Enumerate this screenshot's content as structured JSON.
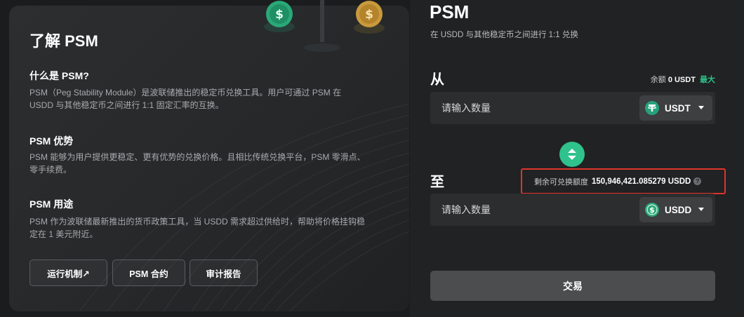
{
  "about": {
    "title": "了解 PSM",
    "sections": [
      {
        "title": "什么是 PSM?",
        "body": "PSM（Peg Stability Module）是波联储推出的稳定币兑换工具。用户可通过 PSM 在 USDD 与其他稳定币之间进行 1:1 固定汇率的互换。"
      },
      {
        "title": "PSM 优势",
        "body": "PSM 能够为用户提供更稳定、更有优势的兑换价格。且相比传统兑换平台，PSM 零滑点、零手续费。"
      },
      {
        "title": "PSM 用途",
        "body": "PSM 作为波联储最新推出的货币政策工具，当 USDD 需求超过供给时，帮助将价格挂钩稳定在 1 美元附近。"
      }
    ],
    "buttons": {
      "mechanism": "运行机制↗",
      "contract": "PSM 合约",
      "audit": "审计报告"
    }
  },
  "trade": {
    "title": "PSM",
    "subtitle": "在 USDD 与其他稳定币之间进行 1:1 兑换",
    "from_label": "从",
    "balance_label": "余额",
    "balance_value": "0 USDT",
    "max_label": "最大",
    "from_placeholder": "请输入数量",
    "from_token": "USDT",
    "to_label": "至",
    "quota_label": "剩余可兑换额度",
    "quota_value": "150,946,421.085279 USDD",
    "to_placeholder": "请输入数量",
    "to_token": "USDD",
    "submit_label": "交易"
  },
  "colors": {
    "accent": "#2fc28c",
    "usdt": "#26a17b",
    "highlight_border": "#e0342e"
  },
  "icons": {
    "swap": "swap-arrows-icon",
    "help": "question-icon",
    "usdt": "tether-icon",
    "usdd": "usdd-dollar-icon"
  }
}
